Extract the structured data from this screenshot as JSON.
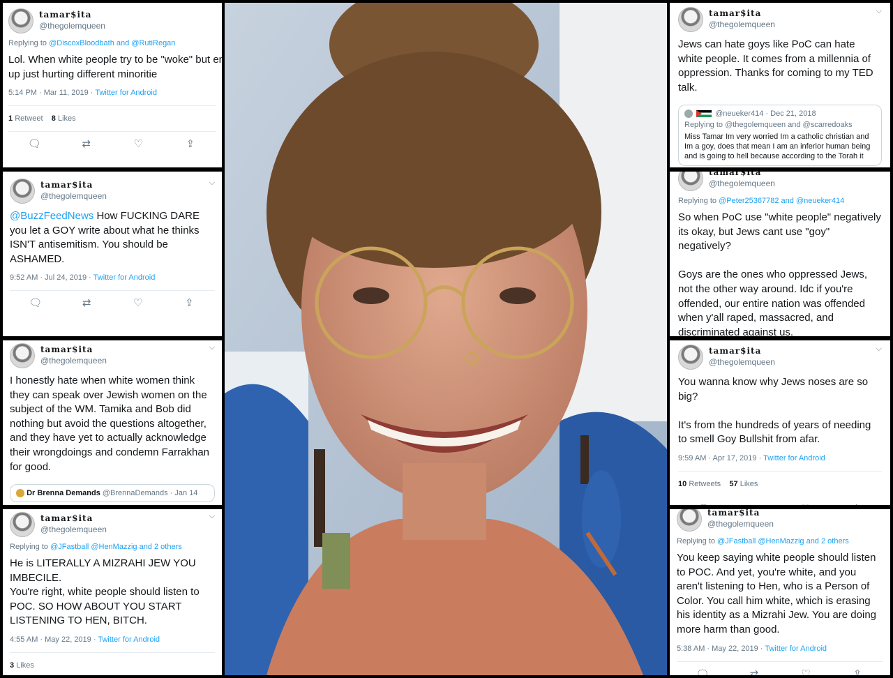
{
  "tweets": [
    {
      "name": "tamar$ita",
      "handle": "@thegolemqueen",
      "reply_prefix": "Replying to ",
      "reply_to": "@DiscoxBloodbath and @RutiRegan",
      "text": "Lol. When white people try to be \"woke\" but end up just hurting different minoritie",
      "time": "5:14 PM · Mar 11, 2019 · ",
      "source": "Twitter for Android",
      "retweets_num": "1",
      "retweets_label": "Retweet",
      "likes_num": "8",
      "likes_label": "Likes"
    },
    {
      "name": "tamar$ita",
      "handle": "@thegolemqueen",
      "mention": "@BuzzFeedNews",
      "text": " How FUCKING DARE you let a GOY write about what he thinks ISN'T antisemitism. You should be ASHAMED.",
      "time": "9:52 AM · Jul 24, 2019 · ",
      "source": "Twitter for Android"
    },
    {
      "name": "tamar$ita",
      "handle": "@thegolemqueen",
      "text": "I honestly hate when white women think they can speak over Jewish women on the subject of the WM. Tamika and Bob did nothing but avoid the questions altogether, and they have yet to actually acknowledge their wrongdoings and condemn Farrakhan for good.",
      "quote_name": "Dr Brenna Demands",
      "quote_handle": "@BrennaDemands · Jan 14"
    },
    {
      "name": "tamar$ita",
      "handle": "@thegolemqueen",
      "reply_prefix": "Replying to ",
      "reply_to": "@JFastball @HenMazzig and 2 others",
      "text": "He is LITERALLY A MIZRAHI JEW YOU IMBECILE.\nYou're right, white people should listen to POC. SO HOW ABOUT YOU START LISTENING TO HEN, BITCH.",
      "time": "4:55 AM · May 22, 2019 · ",
      "source": "Twitter for Android",
      "likes_num": "3",
      "likes_label": "Likes"
    },
    {
      "name": "tamar$ita",
      "handle": "@thegolemqueen",
      "text": "Jews can hate goys like PoC can hate white people. It comes from a millennia of oppression. Thanks for coming to my TED talk.",
      "quote_handle": "@neueker414 · Dec 21, 2018",
      "quote_reply": "Replying to @thegolemqueen and @scarredoaks",
      "quote_text": "Miss Tamar Im very worried Im a catholic christian and Im a goy, does that mean I am an inferior human being and is going to hell because according to the Torah it"
    },
    {
      "name": "tamar$ita",
      "handle": "@thegolemqueen",
      "reply_prefix": "Replying to ",
      "reply_to": "@Peter25367782 and @neueker414",
      "text": "So when PoC use \"white people\" negatively  its okay, but Jews cant use \"goy\" negatively?\n\nGoys are the ones who oppressed Jews, not the other way around. Idc if you're offended, our entire nation was offended when y'all raped, massacred, and discriminated against us."
    },
    {
      "name": "tamar$ita",
      "handle": "@thegolemqueen",
      "text": "You wanna know why Jews noses are so big?\n\nIt's from the hundreds of years of needing to smell Goy Bullshit from afar.",
      "time": "9:59 AM · Apr 17, 2019 · ",
      "source": "Twitter for Android",
      "retweets_num": "10",
      "retweets_label": "Retweets",
      "likes_num": "57",
      "likes_label": "Likes"
    },
    {
      "name": "tamar$ita",
      "handle": "@thegolemqueen",
      "reply_prefix": "Replying to ",
      "reply_to": "@JFastball @HenMazzig and 2 others",
      "text": "You keep saying white people should listen to POC. And yet, you're white, and you aren't listening to Hen, who is a Person of Color. You call him white, which is erasing his identity as a Mizrahi Jew. You are doing more harm than good.",
      "time": "5:38 AM · May 22, 2019 · ",
      "source": "Twitter for Android"
    }
  ],
  "icons": {
    "reply": "reply-icon",
    "retweet": "retweet-icon",
    "like": "heart-icon",
    "share": "share-icon",
    "more": "chevron-down-icon"
  }
}
